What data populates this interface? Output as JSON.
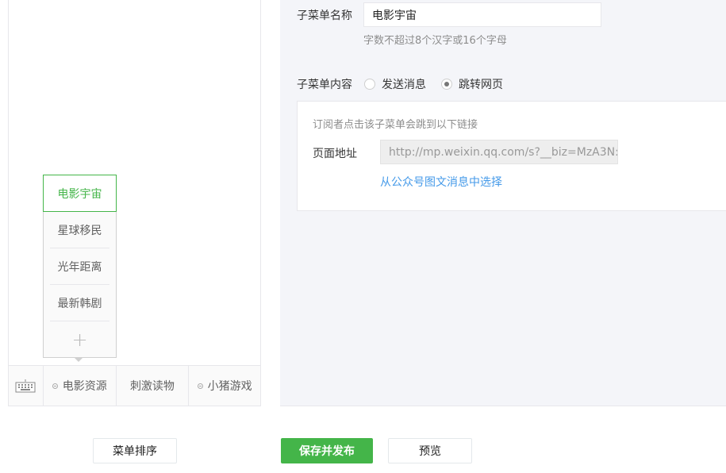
{
  "preview": {
    "submenu": [
      "电影宇宙",
      "星球移民",
      "光年距离",
      "最新韩剧"
    ],
    "menus": [
      "电影资源",
      "刺激读物",
      "小猪游戏"
    ]
  },
  "editor": {
    "name_label": "子菜单名称",
    "name_value": "电影宇宙",
    "name_hint": "字数不超过8个汉字或16个字母",
    "content_label": "子菜单内容",
    "option_send": "发送消息",
    "option_jump": "跳转网页",
    "jump_desc": "订阅者点击该子菜单会跳到以下链接",
    "url_label": "页面地址",
    "url_value": "http://mp.weixin.qq.com/s?__biz=MzA3N:",
    "choose_link": "从公众号图文消息中选择"
  },
  "actions": {
    "sort": "菜单排序",
    "save": "保存并发布",
    "preview": "预览"
  },
  "colors": {
    "accent": "#44b549",
    "link": "#459ae9"
  }
}
